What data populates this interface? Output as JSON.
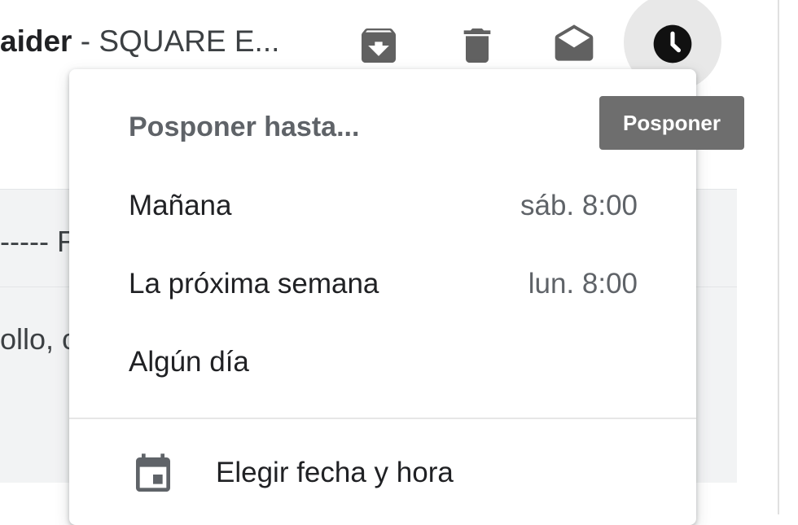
{
  "email_header": {
    "sender": "aider",
    "separator": " - ",
    "subject": "SQUARE E..."
  },
  "email_rows": [
    {
      "snippet": "----- F"
    },
    {
      "snippet": "ollo, c"
    }
  ],
  "toolbar": {
    "archive_icon": "archive-icon",
    "delete_icon": "trash-icon",
    "mark_read_icon": "envelope-open-icon",
    "snooze_icon": "clock-icon"
  },
  "tooltip": {
    "text": "Posponer"
  },
  "snooze_menu": {
    "title": "Posponer hasta...",
    "items": [
      {
        "label": "Mañana",
        "time": "sáb. 8:00"
      },
      {
        "label": "La próxima semana",
        "time": "lun. 8:00"
      },
      {
        "label": "Algún día",
        "time": ""
      }
    ],
    "custom": {
      "label": "Elegir fecha y hora",
      "icon": "calendar-icon"
    }
  },
  "colors": {
    "icon_gray": "#616161",
    "tooltip_bg": "#6e6e6e",
    "list_band": "#f2f3f4"
  }
}
